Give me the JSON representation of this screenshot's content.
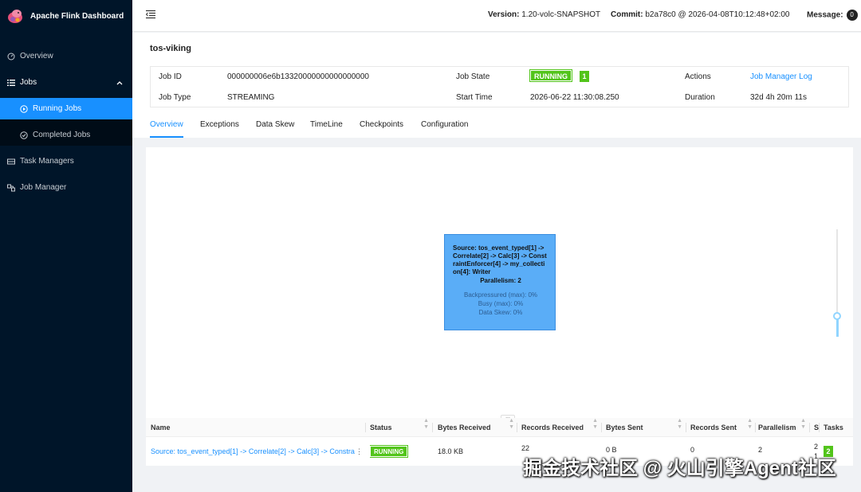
{
  "app": {
    "title": "Apache Flink Dashboard"
  },
  "sidebar": {
    "items": [
      {
        "label": "Overview",
        "icon": "dashboard-icon"
      },
      {
        "label": "Jobs",
        "icon": "list-icon"
      },
      {
        "label": "Task Managers",
        "icon": "server-icon"
      },
      {
        "label": "Job Manager",
        "icon": "cluster-icon"
      }
    ],
    "jobs_sub": [
      {
        "label": "Running Jobs",
        "icon": "play-circle-icon"
      },
      {
        "label": "Completed Jobs",
        "icon": "check-circle-icon"
      }
    ]
  },
  "header": {
    "version_label": "Version:",
    "version_value": "1.20-volc-SNAPSHOT",
    "commit_label": "Commit:",
    "commit_value": "b2a78c0 @ 2026-04-08T10:12:48+02:00",
    "message_label": "Message:",
    "message_count": "0"
  },
  "job": {
    "name": "tos-viking",
    "id_label": "Job ID",
    "id_value": "000000006e6b13320000000000000000",
    "type_label": "Job Type",
    "type_value": "STREAMING",
    "state_label": "Job State",
    "state_value": "RUNNING",
    "state_count": "1",
    "start_label": "Start Time",
    "start_value": "2026-06-22 11:30:08.250",
    "actions_label": "Actions",
    "actions_link": "Job Manager Log",
    "duration_label": "Duration",
    "duration_value": "32d 4h 20m 11s"
  },
  "tabs": [
    "Overview",
    "Exceptions",
    "Data Skew",
    "TimeLine",
    "Checkpoints",
    "Configuration"
  ],
  "graph_node": {
    "title": "Source: tos_event_typed[1] -> Correlate[2] -> Calc[3] -> ConstraintEnforcer[4] -> my_collection[4]: Writer",
    "parallelism": "Parallelism: 2",
    "backpressured": "Backpressured (max): 0%",
    "busy": "Busy (max): 0%",
    "data_skew": "Data Skew: 0%"
  },
  "table": {
    "headers": [
      "Name",
      "Status",
      "Bytes Received",
      "Records Received",
      "Bytes Sent",
      "Records Sent",
      "Parallelism",
      "S",
      "Tasks"
    ],
    "row": {
      "name": "Source: tos_event_typed[1] -> Correlate[2] -> Calc[3] -> Constrai",
      "status": "RUNNING",
      "bytes_received": "18.0 KB",
      "records_received": "22",
      "bytes_sent": "0 B",
      "records_sent": "0",
      "parallelism": "2",
      "s_top": "2",
      "s_bottom": "1",
      "tasks": "2"
    }
  },
  "watermark": "掘金技术社区 @ 火山引擎Agent社区",
  "colors": {
    "sidebar_bg": "#001529",
    "accent": "#1890ff",
    "running": "#52c41a",
    "node_bg": "#5aadf7"
  }
}
